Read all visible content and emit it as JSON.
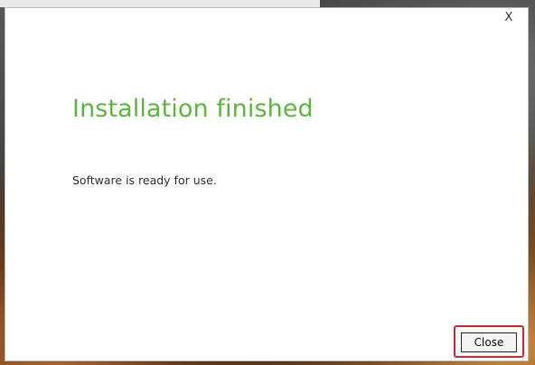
{
  "dialog": {
    "close_icon_glyph": "X",
    "title": "Installation finished",
    "message": "Software is ready for use.",
    "close_button_label": "Close"
  },
  "colors": {
    "title_color": "#59b93a",
    "highlight_color": "#e3232b"
  }
}
